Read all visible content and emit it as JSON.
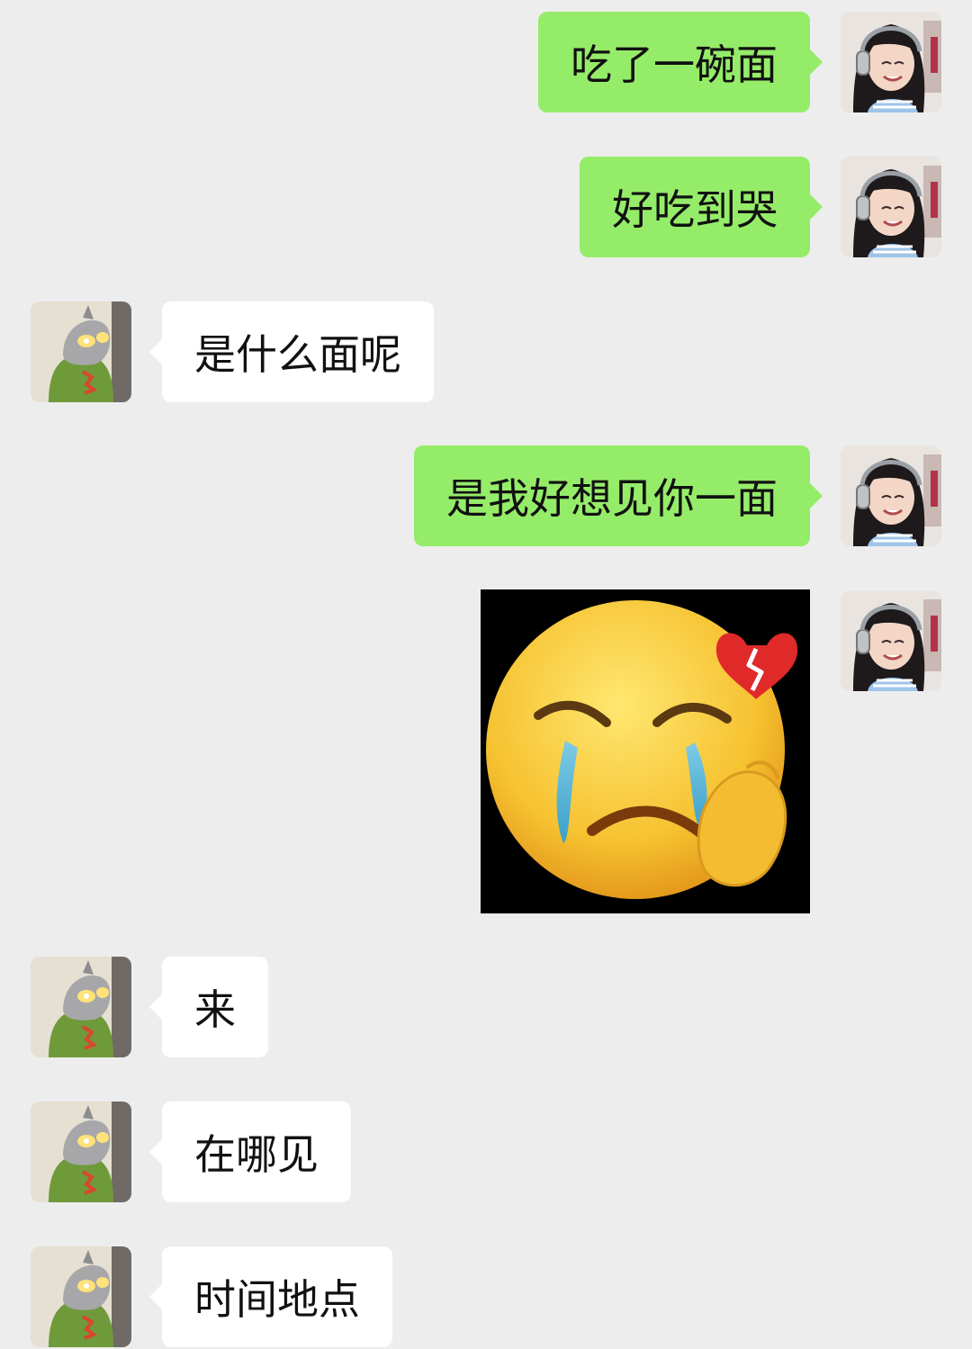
{
  "colors": {
    "background": "#ededed",
    "outgoing_bubble": "#95ec69",
    "incoming_bubble": "#ffffff"
  },
  "messages": [
    {
      "sender": "me",
      "type": "text",
      "text": "吃了一碗面"
    },
    {
      "sender": "me",
      "type": "text",
      "text": "好吃到哭"
    },
    {
      "sender": "other",
      "type": "text",
      "text": "是什么面呢"
    },
    {
      "sender": "me",
      "type": "text",
      "text": "是我好想见你一面"
    },
    {
      "sender": "me",
      "type": "sticker",
      "icon": "crying-face-broken-heart-icon"
    },
    {
      "sender": "other",
      "type": "text",
      "text": "来"
    },
    {
      "sender": "other",
      "type": "text",
      "text": "在哪见"
    },
    {
      "sender": "other",
      "type": "text",
      "text": "时间地点"
    }
  ]
}
